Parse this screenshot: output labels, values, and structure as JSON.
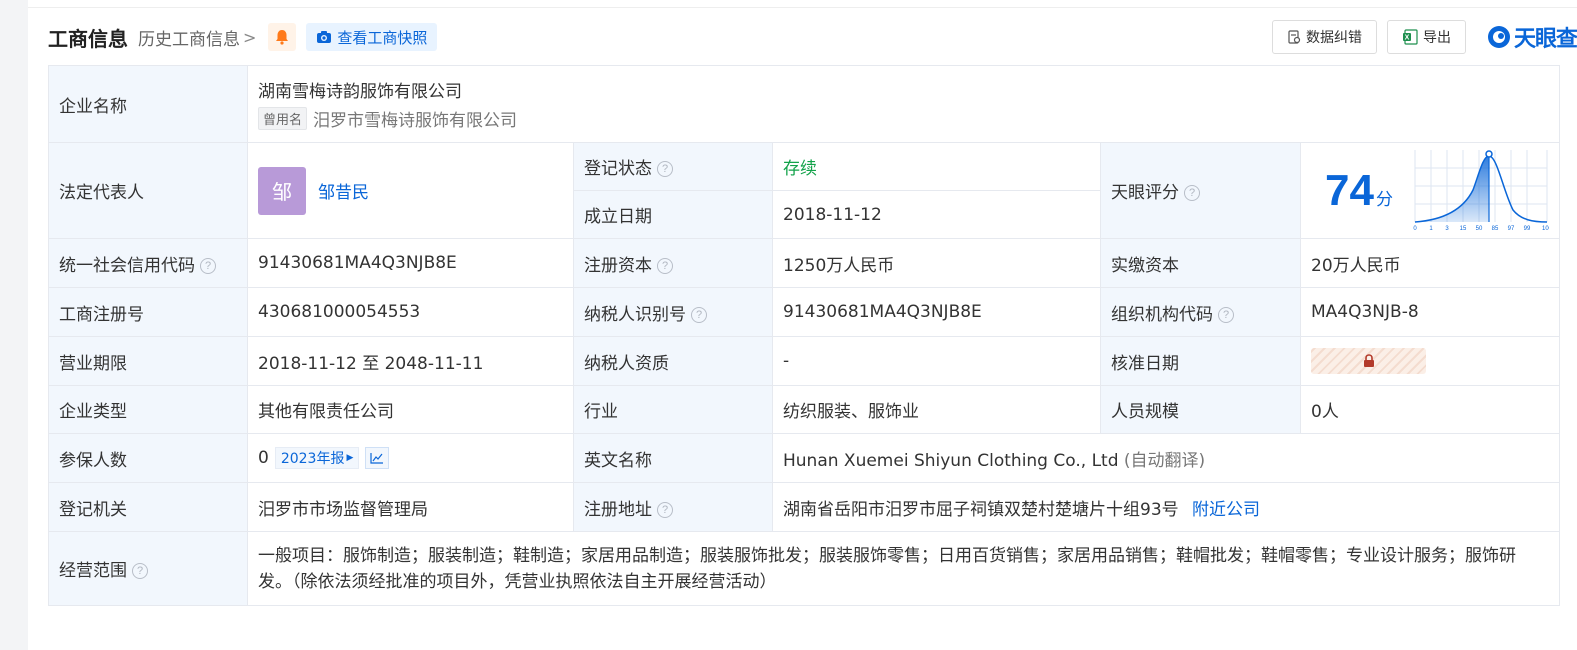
{
  "header": {
    "title": "工商信息",
    "history_link": "历史工商信息",
    "snapshot_label": "查看工商快照",
    "correct_label": "数据纠错",
    "export_label": "导出",
    "logo_text": "天眼查"
  },
  "fields": {
    "company_name_label": "企业名称",
    "company_name": "湖南雪梅诗韵服饰有限公司",
    "former_name_tag": "曾用名",
    "former_name": "汨罗市雪梅诗服饰有限公司",
    "legal_rep_label": "法定代表人",
    "legal_rep_avatar": "邹",
    "legal_rep_name": "邹昔民",
    "reg_status_label": "登记状态",
    "reg_status": "存续",
    "found_date_label": "成立日期",
    "found_date": "2018-11-12",
    "tianyan_score_label": "天眼评分",
    "tianyan_score": "74",
    "score_unit": "分",
    "credit_code_label": "统一社会信用代码",
    "credit_code": "91430681MA4Q3NJB8E",
    "reg_capital_label": "注册资本",
    "reg_capital": "1250万人民币",
    "paid_capital_label": "实缴资本",
    "paid_capital": "20万人民币",
    "biz_reg_no_label": "工商注册号",
    "biz_reg_no": "430681000054553",
    "taxpayer_id_label": "纳税人识别号",
    "taxpayer_id": "91430681MA4Q3NJB8E",
    "org_code_label": "组织机构代码",
    "org_code": "MA4Q3NJB-8",
    "biz_term_label": "营业期限",
    "biz_term": "2018-11-12 至 2048-11-11",
    "taxpayer_qual_label": "纳税人资质",
    "taxpayer_qual": "-",
    "approval_date_label": "核准日期",
    "company_type_label": "企业类型",
    "company_type": "其他有限责任公司",
    "industry_label": "行业",
    "industry": "纺织服装、服饰业",
    "staff_size_label": "人员规模",
    "staff_size": "0人",
    "insured_label": "参保人数",
    "insured": "0",
    "insured_year": "2023年报",
    "english_name_label": "英文名称",
    "english_name": "Hunan Xuemei Shiyun Clothing Co., Ltd",
    "auto_translate": "(自动翻译)",
    "reg_authority_label": "登记机关",
    "reg_authority": "汨罗市市场监督管理局",
    "reg_address_label": "注册地址",
    "reg_address": "湖南省岳阳市汨罗市屈子祠镇双楚村楚塘片十组93号",
    "nearby_company": "附近公司",
    "scope_label": "经营范围",
    "scope": "一般项目：服饰制造；服装制造；鞋制造；家居用品制造；服装服饰批发；服装服饰零售；日用百货销售；家居用品销售；鞋帽批发；鞋帽零售；专业设计服务；服饰研发。（除依法须经批准的项目外，凭营业执照依法自主开展经营活动）"
  },
  "score_chart_ticks": [
    "0",
    "1",
    "3",
    "15",
    "50",
    "85",
    "97",
    "99",
    "100"
  ],
  "colors": {
    "accent": "#0a66d8",
    "status_green": "#13a24a",
    "label_bg": "#f2f7fd",
    "avatar": "#b89ad8"
  }
}
